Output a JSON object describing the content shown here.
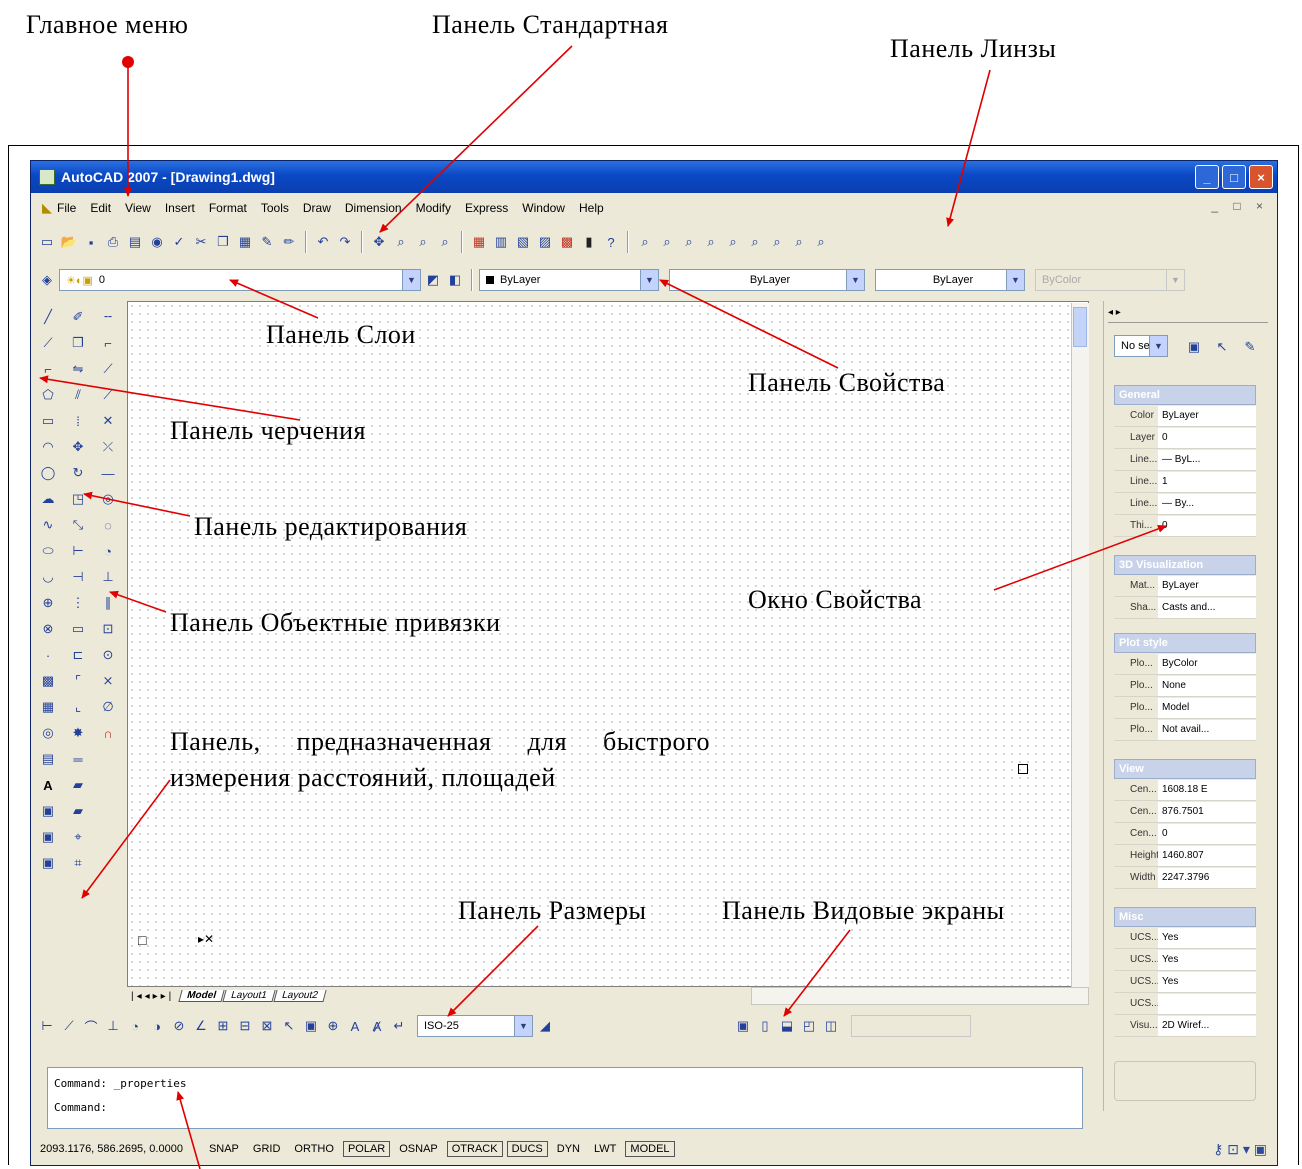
{
  "annotations": {
    "main_menu": "Главное меню",
    "standard_panel": "Панель Стандартная",
    "zoom_panel": "Панель Линзы",
    "layers_panel": "Панель Слои",
    "properties_panel": "Панель Свойства",
    "draw_panel": "Панель черчения",
    "modify_panel": "Панель редактирования",
    "osnap_panel": "Панель Объектные привязки",
    "properties_window": "Окно Свойства",
    "measure_panel": "Панель, предназначенная для быстрого измерения расстояний, площадей",
    "dimension_panel": "Панель Размеры",
    "viewports_panel": "Панель Видовые экраны"
  },
  "window": {
    "title": "AutoCAD 2007 - [Drawing1.dwg]",
    "doc_buttons": "_ □ ×"
  },
  "menu": [
    "File",
    "Edit",
    "View",
    "Insert",
    "Format",
    "Tools",
    "Draw",
    "Dimension",
    "Modify",
    "Express",
    "Window",
    "Help"
  ],
  "layers": {
    "current_layer": "0"
  },
  "properties_toolbar": {
    "color": "ByLayer",
    "linetype": "ByLayer",
    "lineweight": "ByLayer",
    "plotstyle": "ByColor"
  },
  "layout_tabs": [
    "Model",
    "Layout1",
    "Layout2"
  ],
  "dim_style": "ISO-25",
  "command": {
    "line1": "Command: _properties",
    "line2": "Command:"
  },
  "status": {
    "coords": "2093.1176, 586.2695, 0.0000",
    "buttons": [
      "SNAP",
      "GRID",
      "ORTHO",
      "POLAR",
      "OSNAP",
      "OTRACK",
      "DUCS",
      "DYN",
      "LWT",
      "MODEL"
    ]
  },
  "props_window": {
    "selector": "No se",
    "groups": [
      {
        "title": "General",
        "rows": [
          [
            "Color",
            "ByLayer"
          ],
          [
            "Layer",
            "0"
          ],
          [
            "Line...",
            "— ByL..."
          ],
          [
            "Line...",
            "1"
          ],
          [
            "Line...",
            "— By..."
          ],
          [
            "Thi...",
            "0"
          ]
        ]
      },
      {
        "title": "3D Visualization",
        "rows": [
          [
            "Mat...",
            "ByLayer"
          ],
          [
            "Sha...",
            "Casts and..."
          ]
        ]
      },
      {
        "title": "Plot style",
        "rows": [
          [
            "Plo...",
            "ByColor"
          ],
          [
            "Plo...",
            "None"
          ],
          [
            "Plo...",
            "Model"
          ],
          [
            "Plo...",
            "Not avail..."
          ]
        ]
      },
      {
        "title": "View",
        "rows": [
          [
            "Cen...",
            "1608.18 E"
          ],
          [
            "Cen...",
            "876.7501"
          ],
          [
            "Cen...",
            "0"
          ],
          [
            "Height",
            "1460.807"
          ],
          [
            "Width",
            "2247.3796"
          ]
        ]
      },
      {
        "title": "Misc",
        "rows": [
          [
            "UCS...",
            "Yes"
          ],
          [
            "UCS...",
            "Yes"
          ],
          [
            "UCS...",
            "Yes"
          ],
          [
            "UCS...",
            ""
          ],
          [
            "Visu...",
            "2D Wiref..."
          ]
        ]
      }
    ]
  }
}
